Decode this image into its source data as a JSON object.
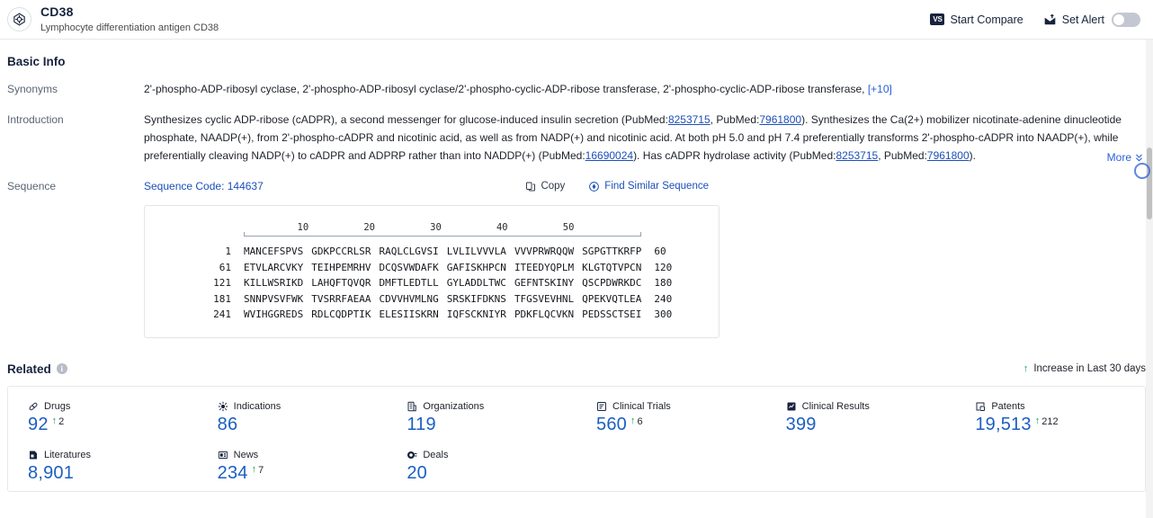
{
  "header": {
    "logo_icon": "target-crosshair-icon",
    "title": "CD38",
    "subtitle": "Lymphocyte differentiation antigen CD38",
    "compare_badge": "VS",
    "compare_label": "Start Compare",
    "alert_icon": "alert-bell-icon",
    "alert_label": "Set Alert",
    "alert_toggle_state": "off"
  },
  "basic_info": {
    "section_title": "Basic Info",
    "synonyms": {
      "label": "Synonyms",
      "value": "2'-phospho-ADP-ribosyl cyclase,  2'-phospho-ADP-ribosyl cyclase/2'-phospho-cyclic-ADP-ribose transferase,  2'-phospho-cyclic-ADP-ribose transferase,",
      "more_count": "[+10]"
    },
    "introduction": {
      "label": "Introduction",
      "part1": "Synthesizes cyclic ADP-ribose (cADPR), a second messenger for glucose-induced insulin secretion (PubMed:",
      "pm1": "8253715",
      "part2": ", PubMed:",
      "pm2": "7961800",
      "part3": "). Synthesizes the Ca(2+) mobilizer nicotinate-adenine dinucleotide phosphate, NAADP(+), from 2'-phospho-cADPR and nicotinic acid, as well as from NADP(+) and nicotinic acid. At both pH 5.0 and pH 7.4 preferentially transforms 2'-phospho-cADPR into NAADP(+), while preferentially cleaving NADP(+) to cADPR and ADPRP rather than into NADDP(+) (PubMed:",
      "pm3": "16690024",
      "part4": "). Has cADPR hydrolase activity (PubMed:",
      "pm4": "8253715",
      "part5": ", PubMed:",
      "pm5": "7961800",
      "part6": ").",
      "more_label": "More",
      "more_icon": "double-chevron-down-icon"
    },
    "sequence": {
      "label": "Sequence",
      "code_label": "Sequence Code: 144637",
      "copy_icon": "copy-icon",
      "copy_label": "Copy",
      "similar_icon": "find-similar-icon",
      "similar_label": "Find Similar Sequence",
      "ruler_ticks": [
        "10",
        "20",
        "30",
        "40",
        "50"
      ],
      "rows": [
        {
          "start": "1",
          "chunks": [
            "MANCEFSPVS",
            "GDKPCCRLSR",
            "RAQLCLGVSI",
            "LVLILVVVLA",
            "VVVPRWRQQW",
            "SGPGTTKRFP"
          ],
          "end": "60"
        },
        {
          "start": "61",
          "chunks": [
            "ETVLARCVKY",
            "TEIHPEMRHV",
            "DCQSVWDAFK",
            "GAFISKHPCN",
            "ITEEDYQPLM",
            "KLGTQTVPCN"
          ],
          "end": "120"
        },
        {
          "start": "121",
          "chunks": [
            "KILLWSRIKD",
            "LAHQFTQVQR",
            "DMFTLEDTLL",
            "GYLADDLTWC",
            "GEFNTSKINY",
            "QSCPDWRKDC"
          ],
          "end": "180"
        },
        {
          "start": "181",
          "chunks": [
            "SNNPVSVFWK",
            "TVSRRFAEAA",
            "CDVVHVMLNG",
            "SRSKIFDKNS",
            "TFGSVEVHNL",
            "QPEKVQTLEA"
          ],
          "end": "240"
        },
        {
          "start": "241",
          "chunks": [
            "WVIHGGREDS",
            "RDLCQDPTIK",
            "ELESIISKRN",
            "IQFSCKNIYR",
            "PDKFLQCVKN",
            "PEDSSCTSEI"
          ],
          "end": "300"
        }
      ]
    }
  },
  "related": {
    "title": "Related",
    "info_icon": "info-icon",
    "legend_arrow": "arrow-up-icon",
    "legend_label": "Increase in Last 30 days",
    "items": [
      {
        "icon": "pill-icon",
        "label": "Drugs",
        "value": "92",
        "delta": "2"
      },
      {
        "icon": "virus-icon",
        "label": "Indications",
        "value": "86",
        "delta": ""
      },
      {
        "icon": "building-icon",
        "label": "Organizations",
        "value": "119",
        "delta": ""
      },
      {
        "icon": "clinical-trial-icon",
        "label": "Clinical Trials",
        "value": "560",
        "delta": "6"
      },
      {
        "icon": "clinical-result-icon",
        "label": "Clinical Results",
        "value": "399",
        "delta": ""
      },
      {
        "icon": "patent-icon",
        "label": "Patents",
        "value": "19,513",
        "delta": "212"
      },
      {
        "icon": "literature-icon",
        "label": "Literatures",
        "value": "8,901",
        "delta": ""
      },
      {
        "icon": "news-icon",
        "label": "News",
        "value": "234",
        "delta": "7"
      },
      {
        "icon": "deal-icon",
        "label": "Deals",
        "value": "20",
        "delta": ""
      }
    ]
  },
  "colors": {
    "accent_blue": "#1b5fc1",
    "link_blue": "#2b5fd9",
    "dark_navy": "#17233d",
    "increase_green": "#18a04a"
  }
}
